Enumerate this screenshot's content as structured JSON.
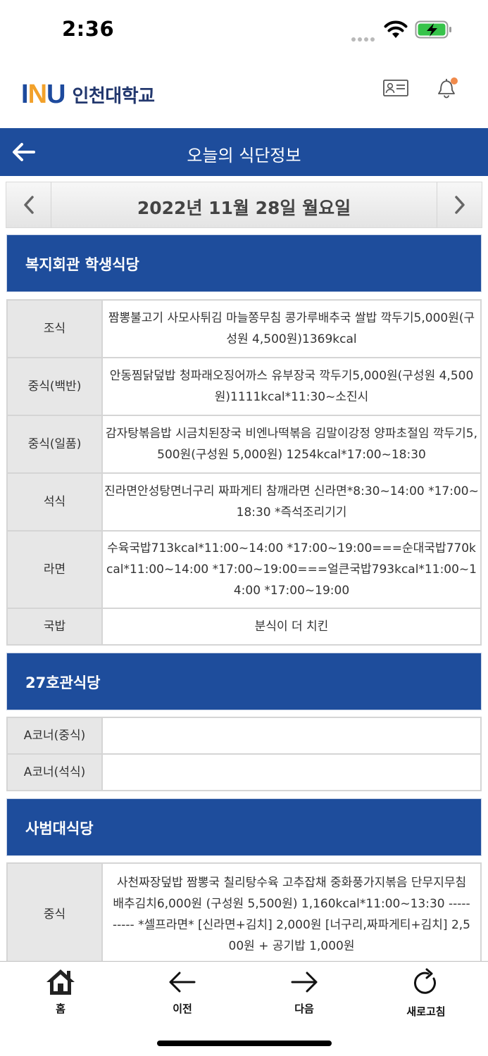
{
  "status_bar": {
    "time": "2:36"
  },
  "header": {
    "logo_mark_1": "I",
    "logo_mark_2": "N",
    "logo_mark_3": "U",
    "logo_text": "인천대학교"
  },
  "title_bar": {
    "title": "오늘의 식단정보"
  },
  "date_nav": {
    "date": "2022년 11월 28일 월요일"
  },
  "sections": [
    {
      "title": "복지회관 학생식당",
      "rows": [
        {
          "label": "조식",
          "content": "짬뽕불고기 사모사튀김 마늘쫑무침 콩가루배추국 쌀밥 깍두기5,000원(구성원 4,500원)1369kcal"
        },
        {
          "label": "중식(백반)",
          "content": "안동찜닭덮밥 청파래오징어까스 유부장국 깍두기5,000원(구성원 4,500원)1111kcal*11:30~소진시"
        },
        {
          "label": "중식(일품)",
          "content": "감자탕볶음밥 시금치된장국 비엔나떡볶음 김말이강정 양파초절임 깍두기5,500원(구성원 5,000원) 1254kcal*17:00~18:30"
        },
        {
          "label": "석식",
          "content": "진라면안성탕면너구리 짜파게티 참깨라면 신라면*8:30~14:00 *17:00~18:30 *즉석조리기기"
        },
        {
          "label": "라면",
          "content": "수육국밥713kcal*11:00~14:00 *17:00~19:00===순대국밥770kcal*11:00~14:00 *17:00~19:00===얼큰국밥793kcal*11:00~14:00 *17:00~19:00"
        },
        {
          "label": "국밥",
          "content": "분식이 더 치킨"
        }
      ]
    },
    {
      "title": "27호관식당",
      "rows": [
        {
          "label": "A코너(중식)",
          "content": ""
        },
        {
          "label": "A코너(석식)",
          "content": ""
        }
      ]
    },
    {
      "title": "사범대식당",
      "rows": [
        {
          "label": "중식",
          "content": "사천짜장덮밥 짬뽕국 칠리탕수육 고추잡채 중화풍가지볶음 단무지무침 배추김치6,000원 (구성원 5,500원) 1,160kcal*11:00~13:30 ---------- *셀프라면* [신라면+김치] 2,000원 [너구리,짜파게티+김치] 2,500원 + 공기밥 1,000원"
        }
      ]
    }
  ],
  "bottom_nav": {
    "home": "홈",
    "prev": "이전",
    "next": "다음",
    "refresh": "새로고침"
  },
  "colors": {
    "primary": "#1e4d9c",
    "accent": "#f2a12a",
    "notification_dot": "#f08a4b"
  }
}
